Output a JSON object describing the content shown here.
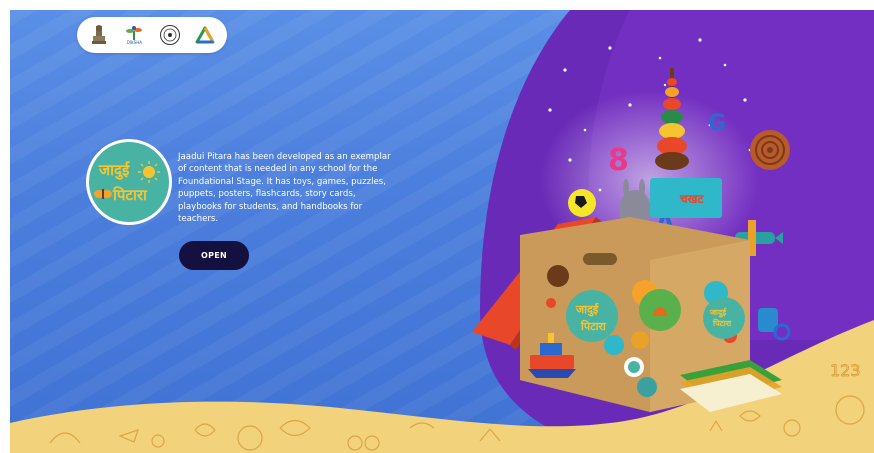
{
  "header": {
    "logos": [
      {
        "icon": "national-emblem-icon"
      },
      {
        "icon": "diksha-logo-icon",
        "caption": "DIKSHA"
      },
      {
        "icon": "ncert-seal-icon"
      },
      {
        "icon": "triangle-logo-icon"
      }
    ]
  },
  "hero": {
    "badge_lines": [
      "जादुई",
      "पिटारा"
    ],
    "description": "Jaadui Pitara has been developed as an exemplar of content that is needed in any school for the Foundational Stage. It has toys, games, puzzles, puppets, posters, flashcards, story cards, playbooks for students, and handbooks for teachers.",
    "open_label": "OPEN"
  },
  "illustration": {
    "box_label_lines": [
      "जादुई",
      "पिटारा"
    ],
    "book_title": "चखट",
    "floating_letters": [
      "8",
      "G",
      "A"
    ],
    "doodle_numbers": "123"
  },
  "colors": {
    "background_blue": "#4a7ddc",
    "purple": "#6a2ab8",
    "sand": "#f2d27a",
    "button": "#14103f",
    "badge": "#49b3a3"
  }
}
